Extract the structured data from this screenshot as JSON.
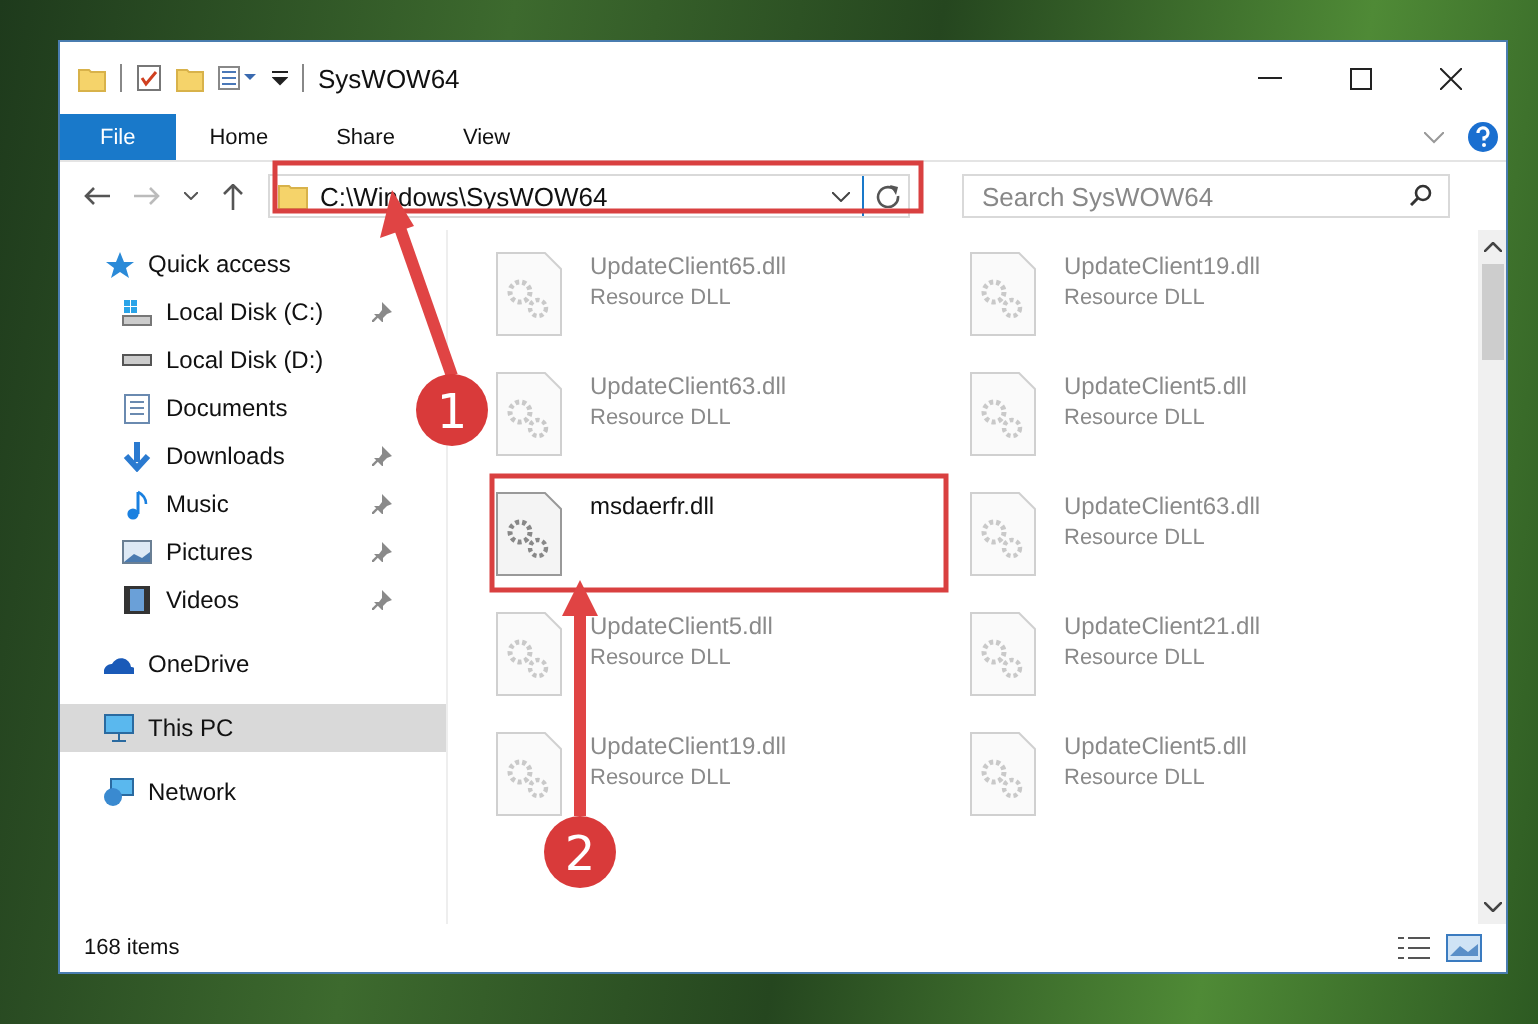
{
  "window": {
    "title": "SysWOW64"
  },
  "ribbon_tabs": [
    {
      "label": "File",
      "selected": true
    },
    {
      "label": "Home",
      "selected": false
    },
    {
      "label": "Share",
      "selected": false
    },
    {
      "label": "View",
      "selected": false
    }
  ],
  "address_bar": {
    "path": "C:\\Windows\\SysWOW64"
  },
  "search": {
    "placeholder": "Search SysWOW64"
  },
  "sidebar": {
    "items": [
      {
        "label": "Quick access",
        "kind": "star",
        "pinned": false,
        "selected": false,
        "children": [
          {
            "label": "Local Disk (C:)",
            "kind": "drive-c",
            "pinned": true,
            "selected": false
          },
          {
            "label": "Local Disk (D:)",
            "kind": "drive",
            "pinned": false,
            "selected": false
          },
          {
            "label": "Documents",
            "kind": "doc",
            "pinned": false,
            "selected": false
          },
          {
            "label": "Downloads",
            "kind": "download",
            "pinned": true,
            "selected": false
          },
          {
            "label": "Music",
            "kind": "music",
            "pinned": true,
            "selected": false
          },
          {
            "label": "Pictures",
            "kind": "picture",
            "pinned": true,
            "selected": false
          },
          {
            "label": "Videos",
            "kind": "video",
            "pinned": true,
            "selected": false
          }
        ]
      },
      {
        "label": "OneDrive",
        "kind": "cloud",
        "pinned": false,
        "selected": false
      },
      {
        "label": "This PC",
        "kind": "pc",
        "pinned": false,
        "selected": true
      },
      {
        "label": "Network",
        "kind": "network",
        "pinned": false,
        "selected": false
      }
    ]
  },
  "files": [
    {
      "name": "UpdateClient65.dll",
      "type": "Resource DLL",
      "dimmed": true
    },
    {
      "name": "UpdateClient19.dll",
      "type": "Resource DLL",
      "dimmed": true
    },
    {
      "name": "UpdateClient63.dll",
      "type": "Resource DLL",
      "dimmed": true
    },
    {
      "name": "UpdateClient5.dll",
      "type": "Resource DLL",
      "dimmed": true
    },
    {
      "name": "msdaerfr.dll",
      "dimmed": false
    },
    {
      "name": "UpdateClient63.dll",
      "type": "Resource DLL",
      "dimmed": true
    },
    {
      "name": "UpdateClient5.dll",
      "type": "Resource DLL",
      "dimmed": true
    },
    {
      "name": "UpdateClient21.dll",
      "type": "Resource DLL",
      "dimmed": true
    },
    {
      "name": "UpdateClient19.dll",
      "type": "Resource DLL",
      "dimmed": true
    },
    {
      "name": "UpdateClient5.dll",
      "type": "Resource DLL",
      "dimmed": true
    }
  ],
  "status_bar": {
    "count": "168 items"
  },
  "annotations": [
    {
      "number": "1"
    },
    {
      "number": "2"
    }
  ]
}
